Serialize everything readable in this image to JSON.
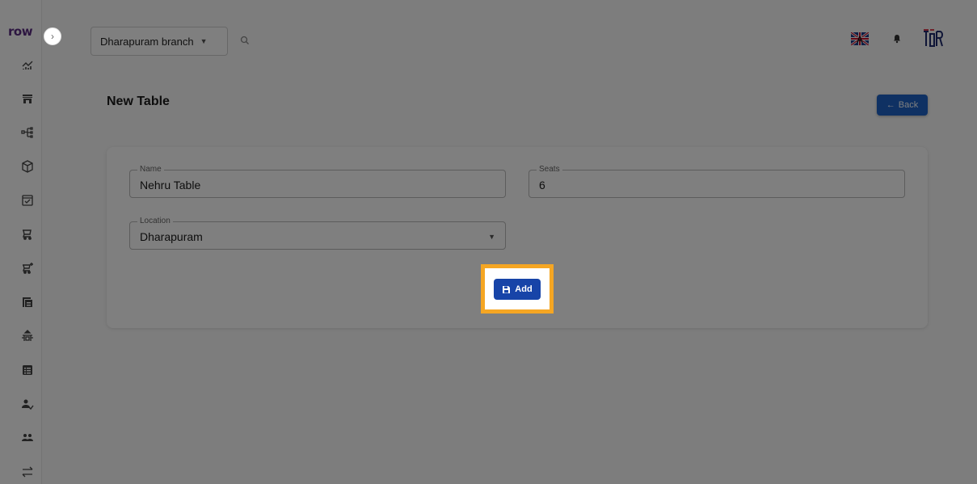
{
  "app": {
    "logo": "row"
  },
  "topbar": {
    "branch": "Dharapuram branch",
    "icons": [
      "search-icon",
      "flag-icon",
      "bell-icon",
      "avatar"
    ]
  },
  "sidebar": {
    "items": [
      "analytics-icon",
      "store-icon",
      "hierarchy-icon",
      "cube-icon",
      "inventory-icon",
      "cart-icon",
      "cart-add-icon",
      "copy-icon",
      "table-icon",
      "list-icon",
      "user-check-icon",
      "group-icon",
      "transfer-icon"
    ]
  },
  "page": {
    "title": "New Table",
    "back_label": "Back"
  },
  "form": {
    "name": {
      "label": "Name",
      "value": "Nehru Table"
    },
    "seats": {
      "label": "Seats",
      "value": "6"
    },
    "location": {
      "label": "Location",
      "value": "Dharapuram"
    },
    "add_label": "Add"
  },
  "colors": {
    "primary": "#1744a8",
    "back": "#1e63c6",
    "highlight": "#f5a623",
    "logo": "#5a2d82"
  }
}
